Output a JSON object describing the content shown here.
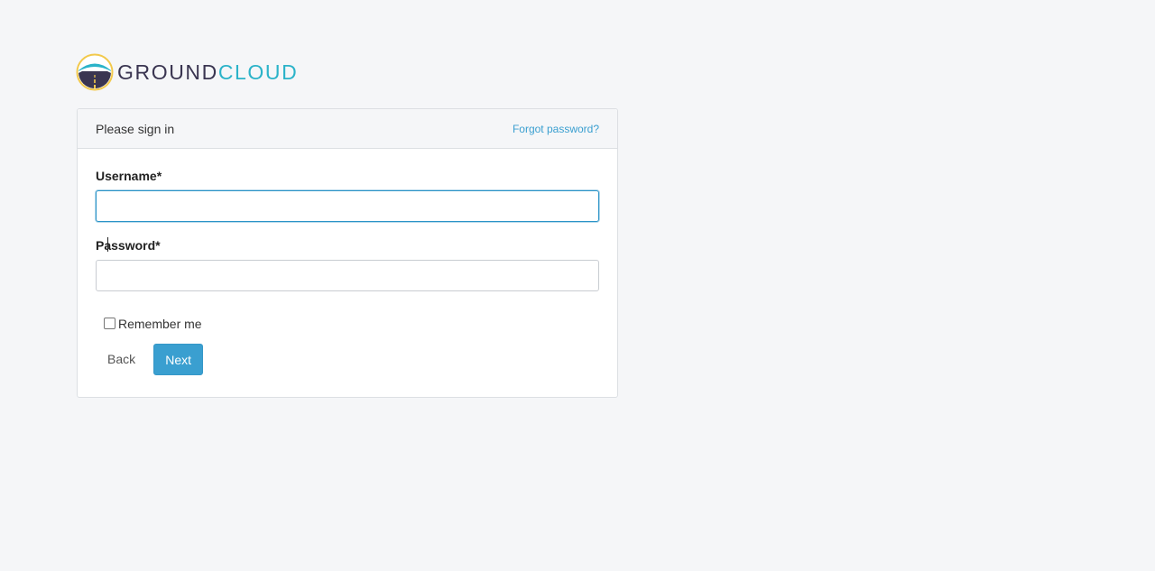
{
  "brand": {
    "name_part1": "GROUND",
    "name_part2": "CLOUD",
    "logo_icon": "road-mountain-logo-icon",
    "colors": {
      "dark": "#3a3551",
      "teal": "#2bb3c9",
      "ring": "#f2c94c"
    }
  },
  "signin": {
    "title": "Please sign in",
    "forgot_password": "Forgot password?",
    "username_label": "Username*",
    "username_value": "",
    "password_label": "Password*",
    "password_value": "",
    "remember_label": "Remember me",
    "remember_checked": false,
    "back_label": "Back",
    "next_label": "Next"
  },
  "colors": {
    "accent": "#3a9fd0",
    "background": "#f5f6f8",
    "focus_border": "#2a93c7"
  }
}
